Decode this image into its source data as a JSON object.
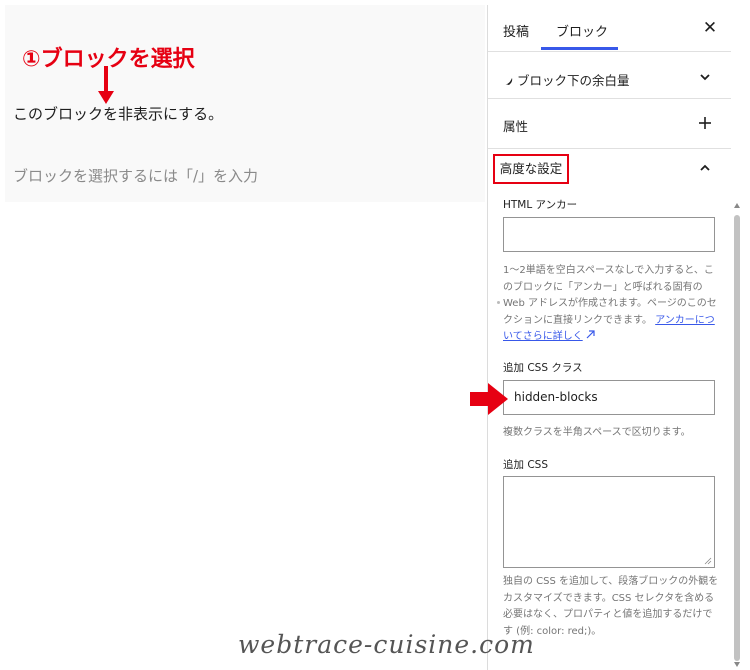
{
  "editor": {
    "annotation_title": "①ブロックを選択",
    "paragraph_text": "このブロックを非表示にする。",
    "block_placeholder": "ブロックを選択するには「/」を入力"
  },
  "sidebar": {
    "tabs": [
      {
        "label": "投稿",
        "active": false
      },
      {
        "label": "ブロック",
        "active": true
      }
    ],
    "close_icon": "close-icon",
    "panels": {
      "spacing_label": "ブロック下の余白量",
      "spacing_icon": "chevron-down-icon",
      "attributes_label": "属性",
      "attributes_icon": "plus-icon",
      "advanced_label": "高度な設定",
      "advanced_icon": "chevron-up-icon"
    },
    "html_anchor": {
      "label": "HTML アンカー",
      "value": "",
      "help_text": "1〜2単語を空白スペースなしで入力すると、このブロックに「アンカー」と呼ばれる固有の Web アドレスが作成されます。ページのこのセクションに直接リンクできます。",
      "help_link": "アンカーについてさらに詳しく",
      "help_link_icon": "external-link-icon"
    },
    "css_class": {
      "label": "追加 CSS クラス",
      "value": "hidden-blocks",
      "help_text": "複数クラスを半角スペースで区切ります。"
    },
    "custom_css": {
      "label": "追加 CSS",
      "value": "",
      "help_text": "独自の CSS を追加して、段落ブロックの外観をカスタマイズできます。CSS セレクタを含める必要はなく、プロパティと値を追加するだけです (例: color: red;)。"
    }
  },
  "watermark": "webtrace-cuisine.com",
  "colors": {
    "annotation_red": "#e60012",
    "accent_blue": "#3858e9",
    "canvas_bg": "#f9f9f9",
    "help_gray": "#757575"
  }
}
